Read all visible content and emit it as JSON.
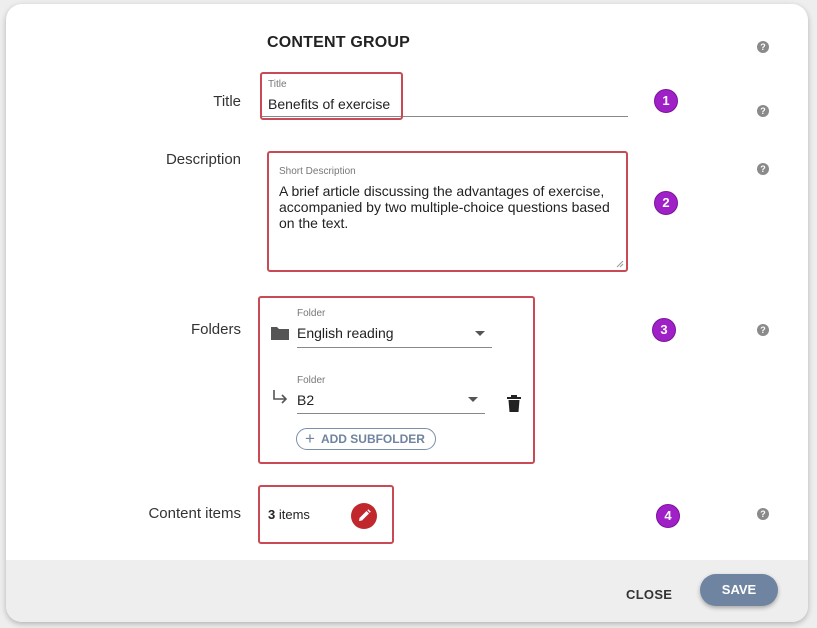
{
  "dialog": {
    "heading": "CONTENT GROUP",
    "help_glyph": "?"
  },
  "title_row": {
    "label": "Title",
    "field_label": "Title",
    "value": "Benefits of exercise",
    "badge": "1"
  },
  "description_row": {
    "label": "Description",
    "field_label": "Short Description",
    "value": "A brief article discussing the advantages of exercise, accompanied by two multiple-choice questions based on the text.",
    "badge": "2"
  },
  "folders_row": {
    "label": "Folders",
    "badge": "3",
    "folder": {
      "field_label": "Folder",
      "value": "English reading",
      "icon": "folder-icon"
    },
    "subfolder": {
      "field_label": "Folder",
      "value": "B2",
      "icon": "subdirectory-arrow-icon",
      "delete_icon": "trash-icon"
    },
    "add_subfolder_label": "ADD SUBFOLDER"
  },
  "content_items_row": {
    "label": "Content items",
    "count": "3",
    "count_suffix": "items",
    "badge": "4",
    "edit_icon": "pencil-icon"
  },
  "footer": {
    "close_label": "CLOSE",
    "save_label": "SAVE"
  },
  "colors": {
    "highlight_border": "#c94a54",
    "badge": "#a020c8",
    "save_button": "#6f84a0",
    "edit_button": "#c0282d"
  }
}
